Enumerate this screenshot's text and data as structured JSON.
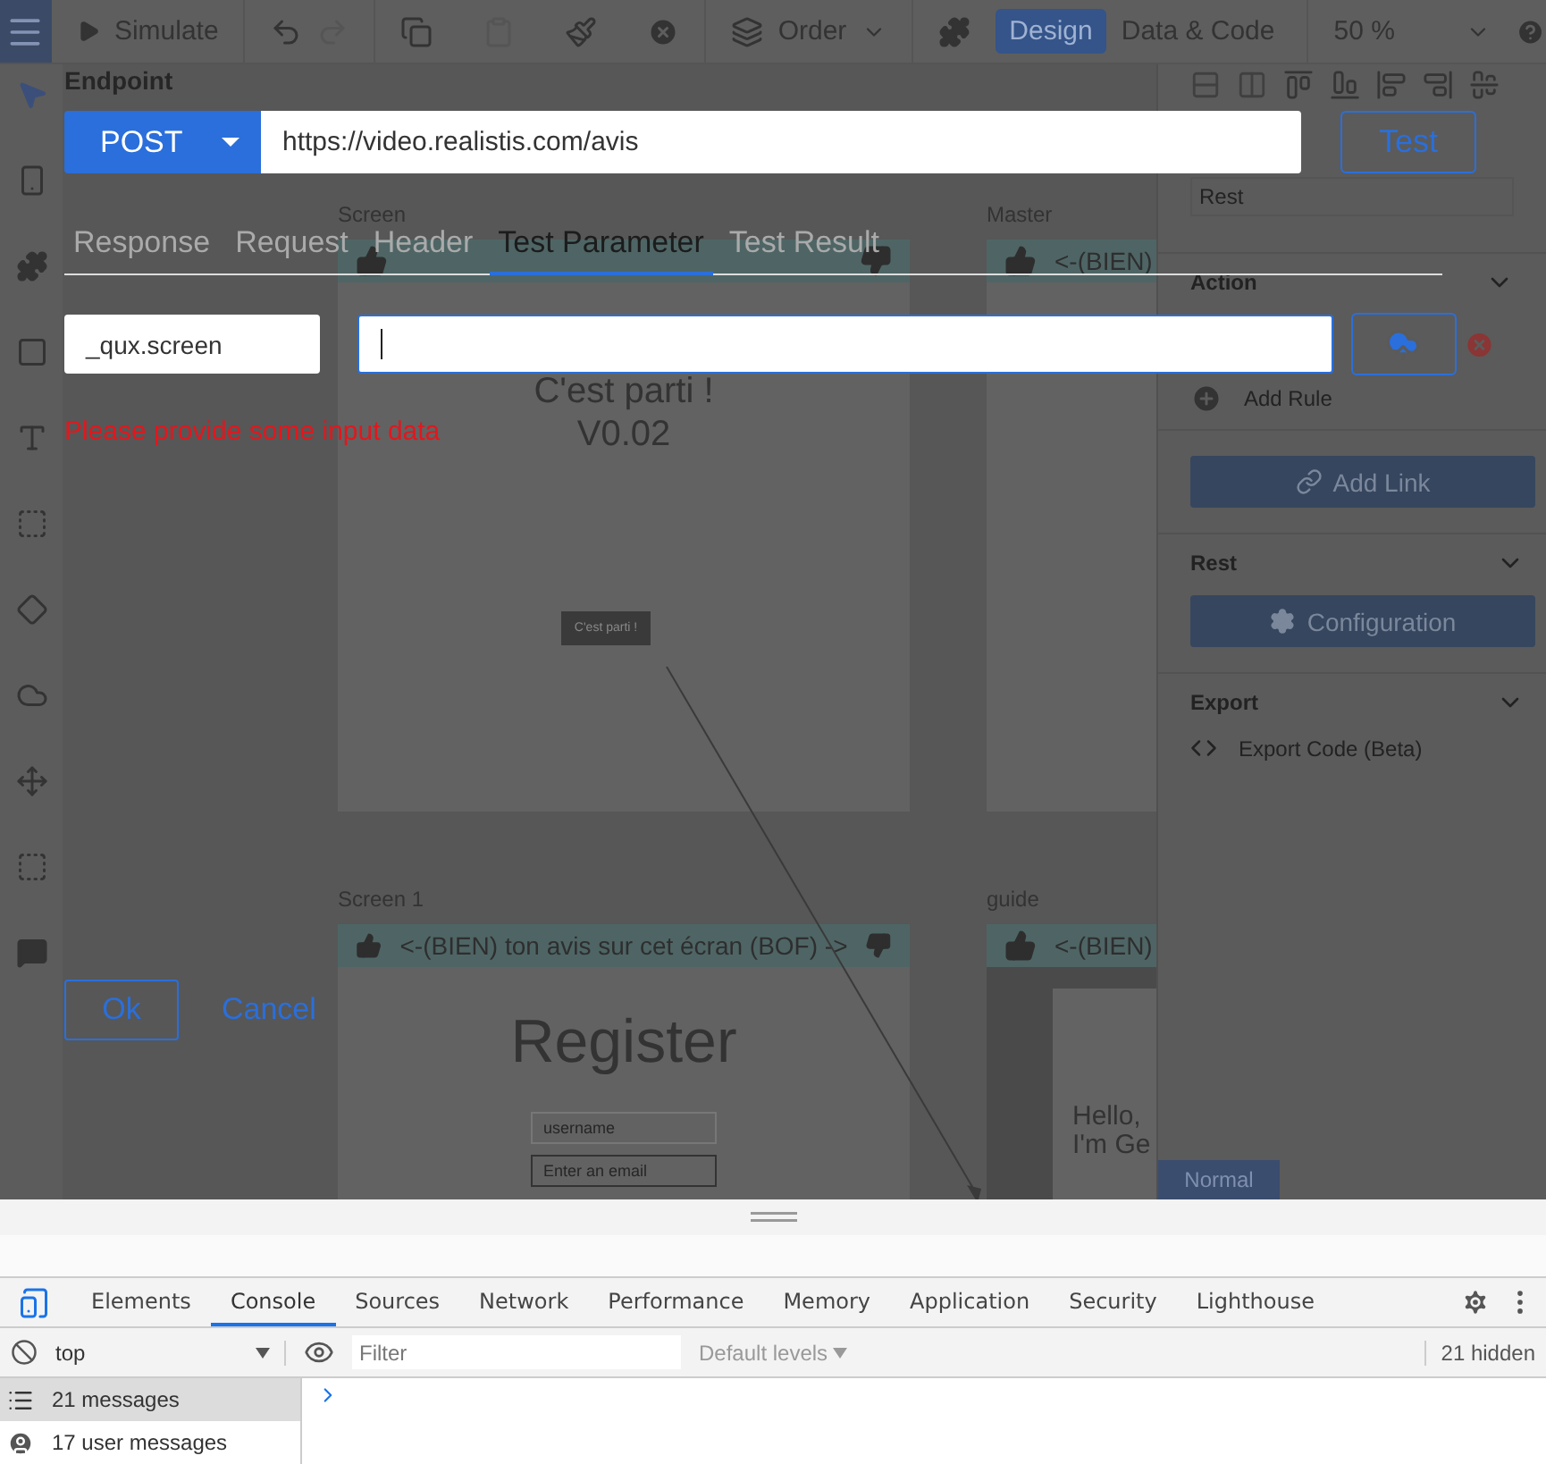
{
  "toolbar": {
    "simulate": "Simulate",
    "order": "Order",
    "modes": [
      {
        "label": "Design",
        "selected": true
      },
      {
        "label": "Data & Code",
        "selected": false
      }
    ],
    "zoom": "50 %"
  },
  "canvas": {
    "screens": [
      {
        "title": "Screen",
        "heading": "C'est parti !",
        "subheading": "V0.02",
        "button": "C'est parti !"
      },
      {
        "title": "Master",
        "banner": "<-(BIEN)"
      },
      {
        "title": "Screen 1",
        "banner": "<-(BIEN) ton avis sur cet écran  (BOF) ->",
        "heading": "Register",
        "fields": [
          "username",
          "Enter an email"
        ]
      },
      {
        "title": "guide",
        "banner": "<-(BIEN)",
        "greeting": [
          "Hello,",
          "I'm Ge"
        ]
      }
    ]
  },
  "properties": {
    "type_value": "Rest",
    "action_title": "Action",
    "add_rule": "Add Rule",
    "add_link": "Add Link",
    "rest_title": "Rest",
    "configuration": "Configuration",
    "export_title": "Export",
    "export_code": "Export Code (Beta)",
    "mode_tab": "Normal"
  },
  "dialog": {
    "title": "Endpoint",
    "method": "POST",
    "url": "https://video.realistis.com/avis",
    "test_button": "Test",
    "tabs": [
      {
        "label": "Response",
        "selected": false
      },
      {
        "label": "Request",
        "selected": false
      },
      {
        "label": "Header",
        "selected": false
      },
      {
        "label": "Test Parameter",
        "selected": true
      },
      {
        "label": "Test Result",
        "selected": false
      }
    ],
    "parameter": {
      "name": "_qux.screen"
    },
    "error": "Please provide some input data",
    "ok": "Ok",
    "cancel": "Cancel"
  },
  "devtools": {
    "tabs": [
      {
        "label": "Elements",
        "selected": false
      },
      {
        "label": "Console",
        "selected": true
      },
      {
        "label": "Sources",
        "selected": false
      },
      {
        "label": "Network",
        "selected": false
      },
      {
        "label": "Performance",
        "selected": false
      },
      {
        "label": "Memory",
        "selected": false
      },
      {
        "label": "Application",
        "selected": false
      },
      {
        "label": "Security",
        "selected": false
      },
      {
        "label": "Lighthouse",
        "selected": false
      }
    ],
    "context": "top",
    "filter_placeholder": "Filter",
    "levels": "Default levels",
    "hidden": "21 hidden",
    "sidebar": [
      {
        "label": "21 messages",
        "selected": true
      },
      {
        "label": "17 user messages",
        "selected": false
      }
    ]
  }
}
